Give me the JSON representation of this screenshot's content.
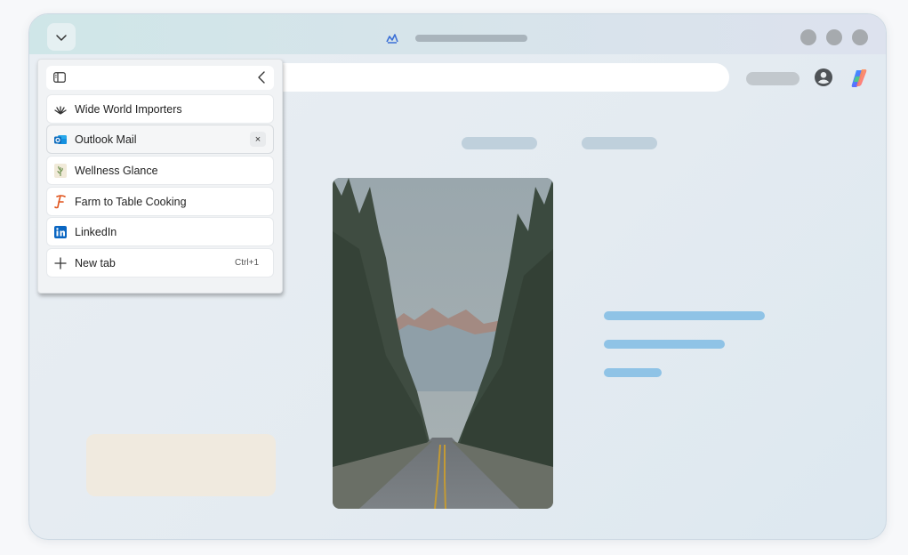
{
  "tabs_panel": {
    "tabs": [
      {
        "label": "Wide World Importers",
        "icon": "plant-logo-icon"
      },
      {
        "label": "Outlook Mail",
        "icon": "outlook-icon",
        "active": true
      },
      {
        "label": "Wellness Glance",
        "icon": "wellness-icon"
      },
      {
        "label": "Farm to Table Cooking",
        "icon": "farm-to-table-icon"
      },
      {
        "label": "LinkedIn",
        "icon": "linkedin-icon"
      }
    ],
    "new_tab": {
      "label": "New tab",
      "shortcut": "Ctrl+1"
    },
    "close_glyph": "×"
  },
  "colors": {
    "text_line": "#8fc3e6",
    "linkedin": "#0a66c2",
    "outlook": "#0f6cbd",
    "farm_to_table": "#e0541d"
  }
}
